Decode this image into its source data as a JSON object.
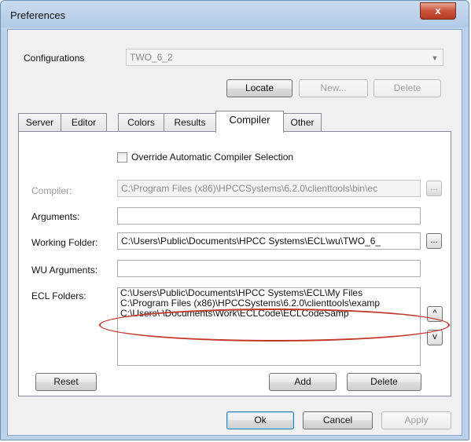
{
  "window": {
    "title": "Preferences",
    "close_glyph": "x"
  },
  "configurations": {
    "label": "Configurations",
    "value": "TWO_6_2",
    "buttons": {
      "locate": "Locate",
      "new": "New...",
      "delete": "Delete"
    }
  },
  "tabs": [
    {
      "label": "Server",
      "active": false
    },
    {
      "label": "Editor",
      "active": false
    },
    {
      "label": "Colors",
      "active": false
    },
    {
      "label": "Results",
      "active": false
    },
    {
      "label": "Compiler",
      "active": true
    },
    {
      "label": "Other",
      "active": false
    }
  ],
  "compiler_tab": {
    "override_label": "Override Automatic Compiler Selection",
    "override_checked": false,
    "compiler": {
      "label": "Compiler:",
      "value": "C:\\Program Files (x86)\\HPCCSystems\\6.2.0\\clienttools\\bin\\ec"
    },
    "arguments": {
      "label": "Arguments:",
      "value": ""
    },
    "working_folder": {
      "label": "Working Folder:",
      "value": "C:\\Users\\Public\\Documents\\HPCC Systems\\ECL\\wu\\TWO_6_"
    },
    "wu_arguments": {
      "label": "WU Arguments:",
      "value": ""
    },
    "ecl_folders": {
      "label": "ECL Folders:",
      "items": [
        "C:\\Users\\Public\\Documents\\HPCC Systems\\ECL\\My Files",
        "C:\\Program Files (x86)\\HPCCSystems\\6.2.0\\clienttools\\examp",
        "C:\\Users\\          \\Documents\\Work\\ECLCode\\ECLCodeSamp"
      ],
      "up_label": "^",
      "down_label": "v"
    },
    "browse_label": "...",
    "reset_label": "Reset",
    "add_label": "Add",
    "delete_label": "Delete"
  },
  "footer": {
    "ok": "Ok",
    "cancel": "Cancel",
    "apply": "Apply"
  },
  "colors": {
    "annotation": "#c0392b",
    "title_bar": "#b3cbe6",
    "close_button": "#c7523b"
  }
}
